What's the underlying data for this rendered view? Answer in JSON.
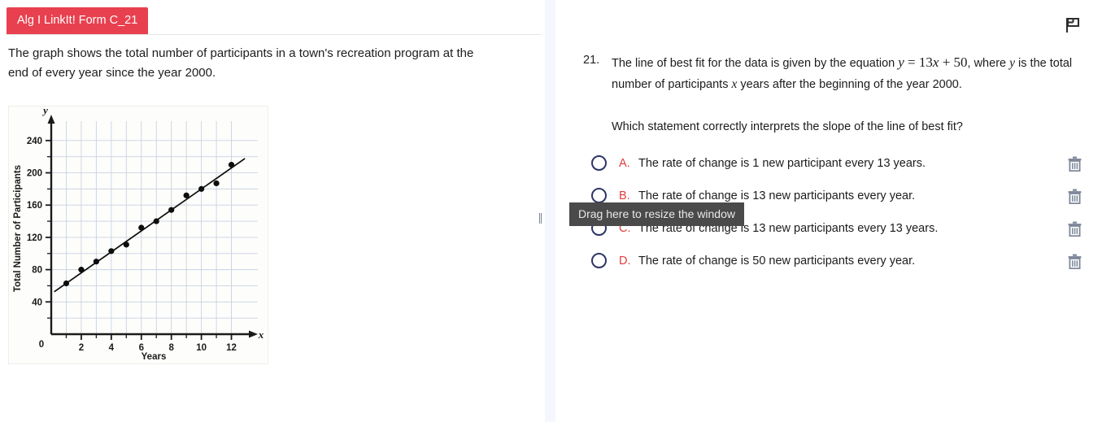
{
  "left_panel": {
    "form_badge": "Alg I LinkIt! Form C_21",
    "stimulus": "The graph shows the total number of participants in a town's recreation program at the end of every year since the year 2000."
  },
  "chart_data": {
    "type": "scatter",
    "title": "",
    "xlabel": "Years",
    "ylabel": "Total Number of Participants",
    "x_axis_var": "x",
    "y_axis_var": "y",
    "origin_label": "0",
    "xlim": [
      0,
      13
    ],
    "ylim": [
      0,
      260
    ],
    "x_ticks": [
      2,
      4,
      6,
      8,
      10,
      12
    ],
    "x_tick_labels": [
      "2",
      "4",
      "6",
      "8",
      "10",
      "12"
    ],
    "y_ticks": [
      40,
      80,
      120,
      160,
      200,
      240
    ],
    "y_tick_labels": [
      "40",
      "80",
      "120",
      "160",
      "200",
      "240"
    ],
    "x_minor_step": 1,
    "y_minor_step": 20,
    "grid": true,
    "legend": "none",
    "x": [
      1,
      2,
      3,
      4,
      5,
      6,
      7,
      8,
      9,
      10,
      11,
      12
    ],
    "values": [
      63,
      80,
      90,
      103,
      111,
      132,
      140,
      154,
      172,
      180,
      187,
      210
    ],
    "trendline": {
      "slope": 13,
      "intercept": 50,
      "label": "y = 13x + 50"
    }
  },
  "splitter": {
    "tooltip": "Drag here to resize the window",
    "grip_icon": "drag-grip-icon"
  },
  "right_panel": {
    "flag_icon": "flag-icon",
    "question_number": "21.",
    "stem_part1": "The line of best fit for the data is given by the equation ",
    "equation": "y = 13x + 50",
    "stem_part2": ", where ",
    "stem_var_y": "y",
    "stem_part3": " is the total number of participants ",
    "stem_var_x": "x",
    "stem_part4": " years after the beginning of the year 2000.",
    "prompt": "Which statement correctly interprets the slope of the line of best fit?",
    "options": [
      {
        "letter": "A.",
        "text": "The rate of change is 1 new participant every 13 years.",
        "selected": false,
        "delete_icon": "trash-icon"
      },
      {
        "letter": "B.",
        "text": "The rate of change is 13 new participants every year.",
        "selected": false,
        "delete_icon": "trash-icon"
      },
      {
        "letter": "C.",
        "text": "The rate of change is 13 new participants every 13 years.",
        "selected": false,
        "delete_icon": "trash-icon"
      },
      {
        "letter": "D.",
        "text": "The rate of change is 50 new participants every year.",
        "selected": false,
        "delete_icon": "trash-icon"
      }
    ]
  },
  "colors": {
    "badge_red": "#e8404f",
    "option_letter_red": "#e23b3b",
    "radio_navy": "#2c3566",
    "trash_gray": "#7d8799",
    "splitter_blue": "#f4f7fd",
    "tooltip_bg": "#4a4a4a",
    "grid_blue": "#c9d2e2"
  }
}
